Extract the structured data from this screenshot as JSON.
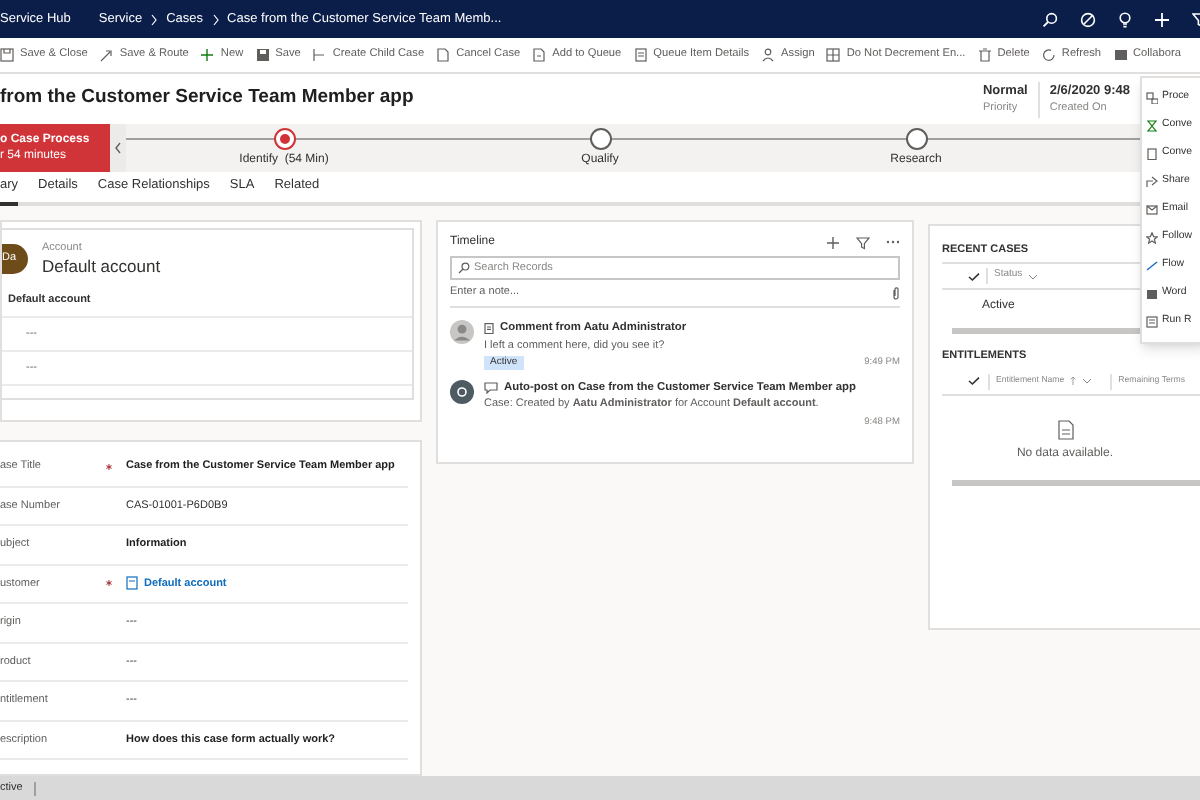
{
  "top_bar": {
    "app_name": "Service Hub",
    "breadcrumb": [
      "Service",
      "Cases",
      "Case from the Customer Service Team Memb..."
    ]
  },
  "command_bar": [
    "Save & Close",
    "Save & Route",
    "New",
    "Save",
    "Create Child Case",
    "Cancel Case",
    "Add to Queue",
    "Queue Item Details",
    "Assign",
    "Do Not Decrement En...",
    "Delete",
    "Refresh",
    "Collabora"
  ],
  "header": {
    "title": "from the Customer Service Team Member app",
    "fields": [
      {
        "value": "Normal",
        "label": "Priority"
      },
      {
        "value": "2/6/2020 9:48",
        "label": "Created On"
      }
    ]
  },
  "process": {
    "name": "o Case Process",
    "duration": "r 54 minutes",
    "stages": [
      {
        "label": "Identify  (54 Min)",
        "active": true
      },
      {
        "label": "Qualify",
        "active": false
      },
      {
        "label": "Research",
        "active": false
      }
    ]
  },
  "tabs": [
    {
      "label": "ary",
      "selected": true
    },
    {
      "label": "Details",
      "selected": false
    },
    {
      "label": "Case Relationships",
      "selected": false
    },
    {
      "label": "SLA",
      "selected": false
    },
    {
      "label": "Related",
      "selected": false
    }
  ],
  "account_card": {
    "initials": "Da",
    "label": "Account",
    "name": "Default account",
    "rows": [
      "Default account",
      "---",
      "---"
    ]
  },
  "fields": [
    {
      "label": "ase Title",
      "required": true,
      "value": "Case from the Customer Service Team Member app",
      "kind": "text"
    },
    {
      "label": "ase Number",
      "required": false,
      "value": "CAS-01001-P6D0B9",
      "kind": "plain"
    },
    {
      "label": "ubject",
      "required": false,
      "value": "Information",
      "kind": "text"
    },
    {
      "label": "ustomer",
      "required": true,
      "value": "Default account",
      "kind": "link"
    },
    {
      "label": "rigin",
      "required": false,
      "value": "---",
      "kind": "plain"
    },
    {
      "label": "roduct",
      "required": false,
      "value": "---",
      "kind": "plain"
    },
    {
      "label": "ntitlement",
      "required": false,
      "value": "---",
      "kind": "plain"
    },
    {
      "label": "escription",
      "required": false,
      "value": "How does this case form actually work?",
      "kind": "text"
    }
  ],
  "timeline": {
    "title": "Timeline",
    "search_placeholder": "Search Records",
    "note_placeholder": "Enter a note...",
    "entries": [
      {
        "kind": "comment",
        "title": "Comment from Aatu Administrator",
        "body": "I left a comment here, did you see it?",
        "badge": "Active",
        "time": "9:49 PM"
      },
      {
        "kind": "autopost",
        "title": "Auto-post on Case from the Customer Service Team Member app",
        "body": "Case: Created by **Aatu Administrator** for Account **Default account**.",
        "time": "9:48 PM"
      }
    ]
  },
  "recent_cases": {
    "title": "RECENT CASES",
    "column": "Status",
    "rows": [
      "Active"
    ]
  },
  "entitlements": {
    "title": "ENTITLEMENTS",
    "columns": [
      "Entitlement Name",
      "Remaining Terms"
    ],
    "empty": "No data available."
  },
  "menu": [
    "Proce",
    "Conve",
    "Conve",
    "Share",
    "Email",
    "Follow",
    "Flow",
    "Word",
    "Run R"
  ],
  "status_bar": "ctive"
}
